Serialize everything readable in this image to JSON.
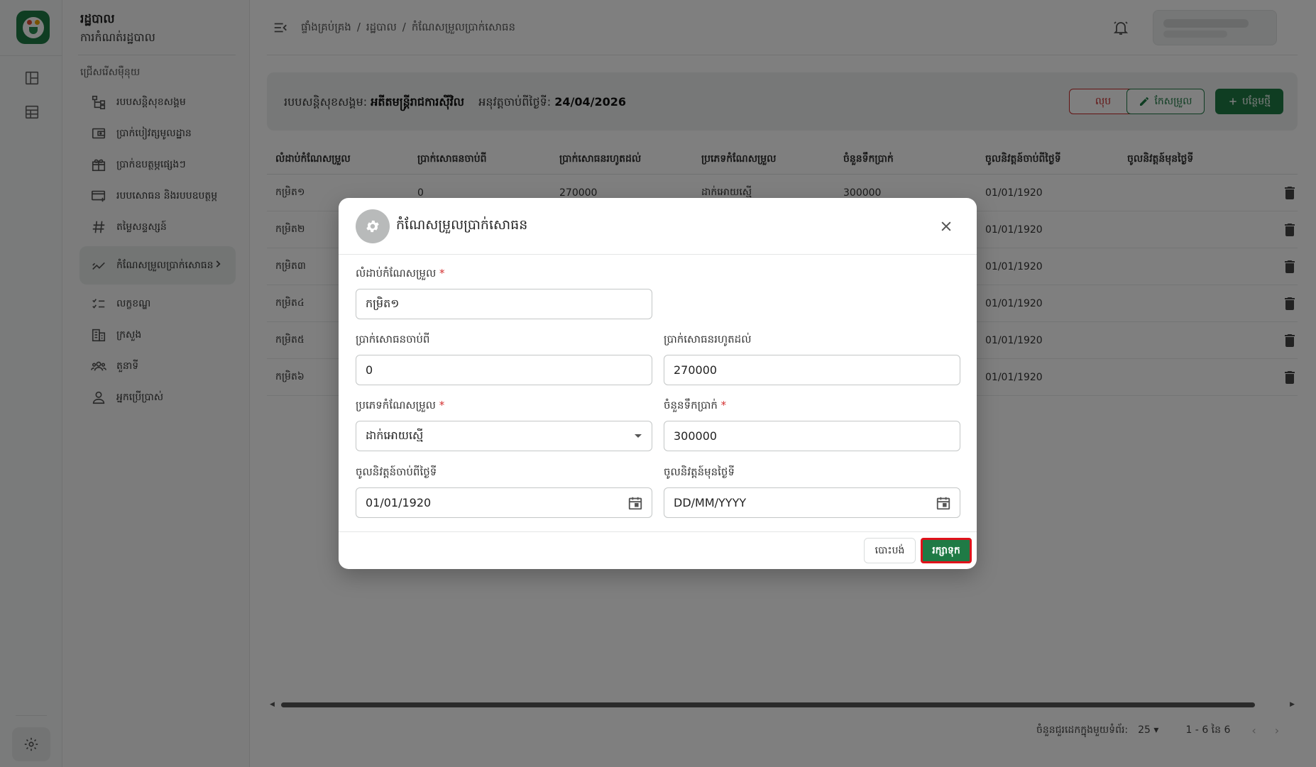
{
  "rail": {
    "icons": [
      "dashboard-icon",
      "table-icon",
      "gear-icon"
    ]
  },
  "sidebar": {
    "title": "រដ្ឋបាល",
    "subtitle": "ការកំណត់រដ្ឋបាល",
    "section": "ជ្រើសរើសម៉ឺនុយ",
    "items": [
      {
        "label": "របបសន្តិសុខសង្គម",
        "icon": "hierarchy-icon"
      },
      {
        "label": "ប្រាក់បៀវត្សមូលដ្ឋាន",
        "icon": "wallet-icon"
      },
      {
        "label": "ប្រាក់ឧបត្ថម្ភផ្សេងៗ",
        "icon": "gift-icon"
      },
      {
        "label": "របបសោធន និងរបបឧបត្ថម្ភ",
        "icon": "card-add-icon"
      },
      {
        "label": "តម្លៃសន្ទស្សន៍",
        "icon": "hash-icon"
      },
      {
        "label": "កំណែសម្រួលប្រាក់សោធន",
        "icon": "chart-line-icon"
      },
      {
        "label": "លក្ខខណ្ឌ",
        "icon": "checklist-icon"
      },
      {
        "label": "ក្រសួង",
        "icon": "building-icon"
      },
      {
        "label": "តួនាទី",
        "icon": "group-icon"
      },
      {
        "label": "អ្នកប្រើប្រាស់",
        "icon": "user-icon"
      }
    ]
  },
  "header": {
    "breadcrumb": [
      "ផ្ទាំងគ្រប់គ្រង",
      "/",
      "រដ្ឋបាល",
      "/",
      "កំណែសម្រួលប្រាក់សោធន"
    ]
  },
  "info": {
    "scheme_label": "របបសន្តិសុខសង្គម:",
    "scheme_value": "អតីតមន្ត្រីរាជការស៊ីវិល",
    "effective_label": "អនុវត្តចាប់ពីថ្ងៃទី:",
    "effective_value": "24/04/2026",
    "delete_label": "លុប",
    "edit_label": "កែសម្រួល",
    "add_label": "បន្ថែមថ្មី"
  },
  "table": {
    "headers": [
      "លំដាប់កំណែសម្រួល",
      "ប្រាក់សោធនចាប់ពី",
      "ប្រាក់សោធនរហូតដល់",
      "ប្រភេទកំណែសម្រួល",
      "ចំនួនទឹកប្រាក់",
      "ចូលនិវត្តន៍ចាប់ពីថ្ងៃទី",
      "ចូលនិវត្តន៍មុនថ្ងៃទី"
    ],
    "rows": [
      [
        "កម្រិត១",
        "0",
        "270000",
        "ដាក់អោយស្មើ",
        "300000",
        "01/01/1920",
        ""
      ],
      [
        "កម្រិត២",
        "",
        "",
        "",
        "",
        "01/01/1920",
        ""
      ],
      [
        "កម្រិត៣",
        "",
        "",
        "",
        "",
        "01/01/1920",
        ""
      ],
      [
        "កម្រិត៤",
        "",
        "",
        "",
        "",
        "01/01/1920",
        ""
      ],
      [
        "កម្រិត៥",
        "",
        "",
        "",
        "",
        "01/01/1920",
        ""
      ],
      [
        "កម្រិត៦",
        "",
        "",
        "",
        "",
        "01/01/1920",
        ""
      ]
    ]
  },
  "pager": {
    "rows_per_page_label": "ចំនួនជួរដេកក្នុងមួយទំព័រ:",
    "rows_per_page": "25",
    "range": "1 - 6 នៃ 6"
  },
  "modal": {
    "title": "កំណែសម្រួលប្រាក់សោធន",
    "fields": {
      "level_label": "លំដាប់កំណែសម្រួល",
      "level_value": "កម្រិត១",
      "from_label": "ប្រាក់សោធនចាប់ពី",
      "from_value": "0",
      "to_label": "ប្រាក់សោធនរហូតដល់",
      "to_value": "270000",
      "type_label": "ប្រភេទកំណែសម្រួល",
      "type_value": "ដាក់អោយស្មើ",
      "amount_label": "ចំនួនទឹកប្រាក់",
      "amount_value": "300000",
      "retire_from_label": "ចូលនិវត្តន៍ចាប់ពីថ្ងៃទី",
      "retire_from_value": "01/01/1920",
      "retire_before_label": "ចូលនិវត្តន៍មុនថ្ងៃទី",
      "retire_before_placeholder": "DD/MM/YYYY"
    },
    "required_mark": "*",
    "cancel_label": "បោះបង់",
    "save_label": "រក្សាទុក"
  },
  "colors": {
    "brand": "#1f7a45",
    "danger": "#c62828",
    "save_outline": "#e0121b"
  }
}
